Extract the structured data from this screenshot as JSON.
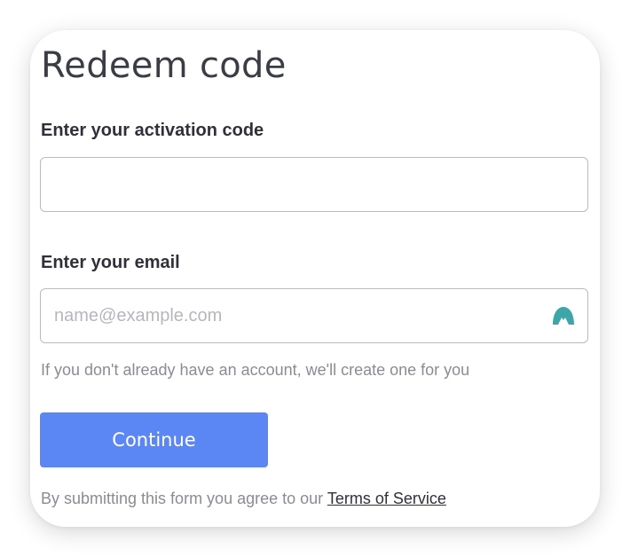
{
  "form": {
    "title": "Redeem code",
    "activation_label": "Enter your activation code",
    "activation_value": "",
    "activation_placeholder": "",
    "email_label": "Enter your email",
    "email_value": "",
    "email_placeholder": "name@example.com",
    "email_icon": "autofill-icon",
    "hint": "If you don't already have an account, we'll create one for you",
    "continue_label": "Continue",
    "terms_prefix": "By submitting this form you agree to our ",
    "terms_link": "Terms of Service"
  },
  "colors": {
    "accent": "#5b87f5",
    "icon_teal": "#3ea5a8"
  }
}
